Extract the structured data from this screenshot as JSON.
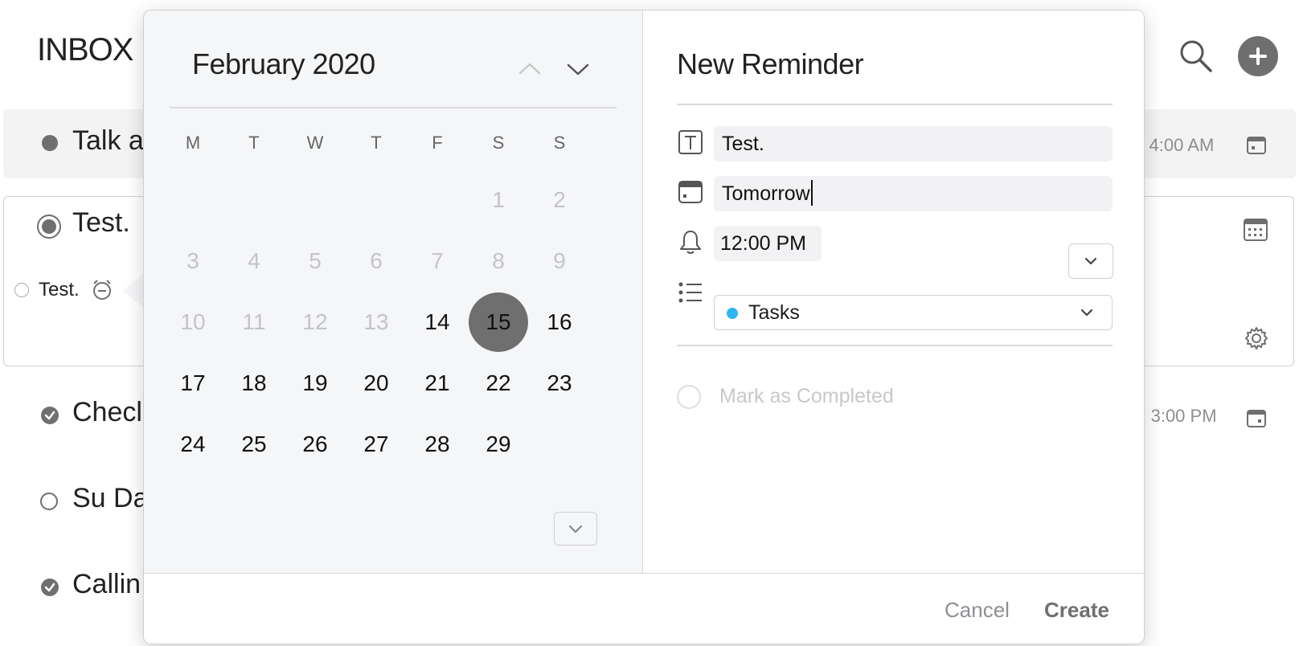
{
  "inbox": {
    "title": "INBOX",
    "rows": [
      {
        "title": "Talk a",
        "time": "), 4:00 AM"
      },
      {
        "title": "Test.",
        "subtask": "Test."
      },
      {
        "title": "Checl",
        "time": "y, 3:00 PM"
      },
      {
        "title": "Su Da"
      },
      {
        "title": "Callin"
      }
    ]
  },
  "calendar": {
    "month_label": "February 2020",
    "weekdays": [
      "M",
      "T",
      "W",
      "T",
      "F",
      "S",
      "S"
    ],
    "days": [
      {
        "n": "1",
        "state": "disabled"
      },
      {
        "n": "2",
        "state": "disabled"
      },
      {
        "n": "3",
        "state": "disabled"
      },
      {
        "n": "4",
        "state": "disabled"
      },
      {
        "n": "5",
        "state": "disabled"
      },
      {
        "n": "6",
        "state": "disabled"
      },
      {
        "n": "7",
        "state": "disabled"
      },
      {
        "n": "8",
        "state": "disabled"
      },
      {
        "n": "9",
        "state": "disabled"
      },
      {
        "n": "10",
        "state": "disabled"
      },
      {
        "n": "11",
        "state": "disabled"
      },
      {
        "n": "12",
        "state": "disabled"
      },
      {
        "n": "13",
        "state": "disabled"
      },
      {
        "n": "14",
        "state": "active"
      },
      {
        "n": "15",
        "state": "selected"
      },
      {
        "n": "16",
        "state": "active"
      },
      {
        "n": "17",
        "state": "active"
      },
      {
        "n": "18",
        "state": "active"
      },
      {
        "n": "19",
        "state": "active"
      },
      {
        "n": "20",
        "state": "active"
      },
      {
        "n": "21",
        "state": "active"
      },
      {
        "n": "22",
        "state": "active"
      },
      {
        "n": "23",
        "state": "active"
      },
      {
        "n": "24",
        "state": "active"
      },
      {
        "n": "25",
        "state": "active"
      },
      {
        "n": "26",
        "state": "active"
      },
      {
        "n": "27",
        "state": "active"
      },
      {
        "n": "28",
        "state": "active"
      },
      {
        "n": "29",
        "state": "active"
      }
    ]
  },
  "form": {
    "title": "New Reminder",
    "name_value": "Test.",
    "date_value": "Tomorrow",
    "time_value": "12:00 PM",
    "list_value": "Tasks",
    "list_color": "#2fb5f0",
    "mark_completed_label": "Mark as Completed"
  },
  "footer": {
    "cancel_label": "Cancel",
    "create_label": "Create"
  },
  "colors": {
    "accent_gray": "#6f6f6f",
    "list_blue": "#2fb5f0"
  }
}
